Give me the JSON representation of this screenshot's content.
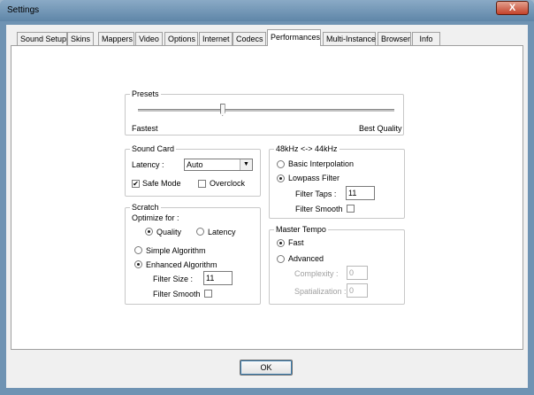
{
  "window": {
    "title": "Settings",
    "close_glyph": "X"
  },
  "tabs": [
    {
      "label": "Sound Setup"
    },
    {
      "label": "Skins"
    },
    {
      "label": "Mappers"
    },
    {
      "label": "Video"
    },
    {
      "label": "Options"
    },
    {
      "label": "Internet"
    },
    {
      "label": "Codecs"
    },
    {
      "label": "Performances"
    },
    {
      "label": "Multi-Instance"
    },
    {
      "label": "Browser"
    },
    {
      "label": "Info"
    }
  ],
  "selected_tab": "Performances",
  "presets": {
    "title": "Presets",
    "left_label": "Fastest",
    "right_label": "Best Quality",
    "slider_value": 0.33
  },
  "sound_card": {
    "title": "Sound Card",
    "latency_label": "Latency :",
    "latency_value": "Auto",
    "safe_mode_label": "Safe Mode",
    "safe_mode_checked": true,
    "overclock_label": "Overclock",
    "overclock_checked": false
  },
  "scratch": {
    "title": "Scratch",
    "optimize_label": "Optimize for :",
    "quality_label": "Quality",
    "latency_label": "Latency",
    "simple_label": "Simple Algorithm",
    "enhanced_label": "Enhanced Algorithm",
    "filter_size_label": "Filter Size :",
    "filter_size_value": "11",
    "filter_smooth_label": "Filter Smooth"
  },
  "resample": {
    "title": "48kHz <-> 44kHz",
    "basic_label": "Basic Interpolation",
    "lowpass_label": "Lowpass Filter",
    "filter_taps_label": "Filter Taps :",
    "filter_taps_value": "11",
    "filter_smooth_label": "Filter Smooth"
  },
  "master_tempo": {
    "title": "Master Tempo",
    "fast_label": "Fast",
    "advanced_label": "Advanced",
    "complexity_label": "Complexity :",
    "complexity_value": "0",
    "spatialization_label": "Spatialization :",
    "spatialization_value": "0"
  },
  "ok_label": "OK"
}
